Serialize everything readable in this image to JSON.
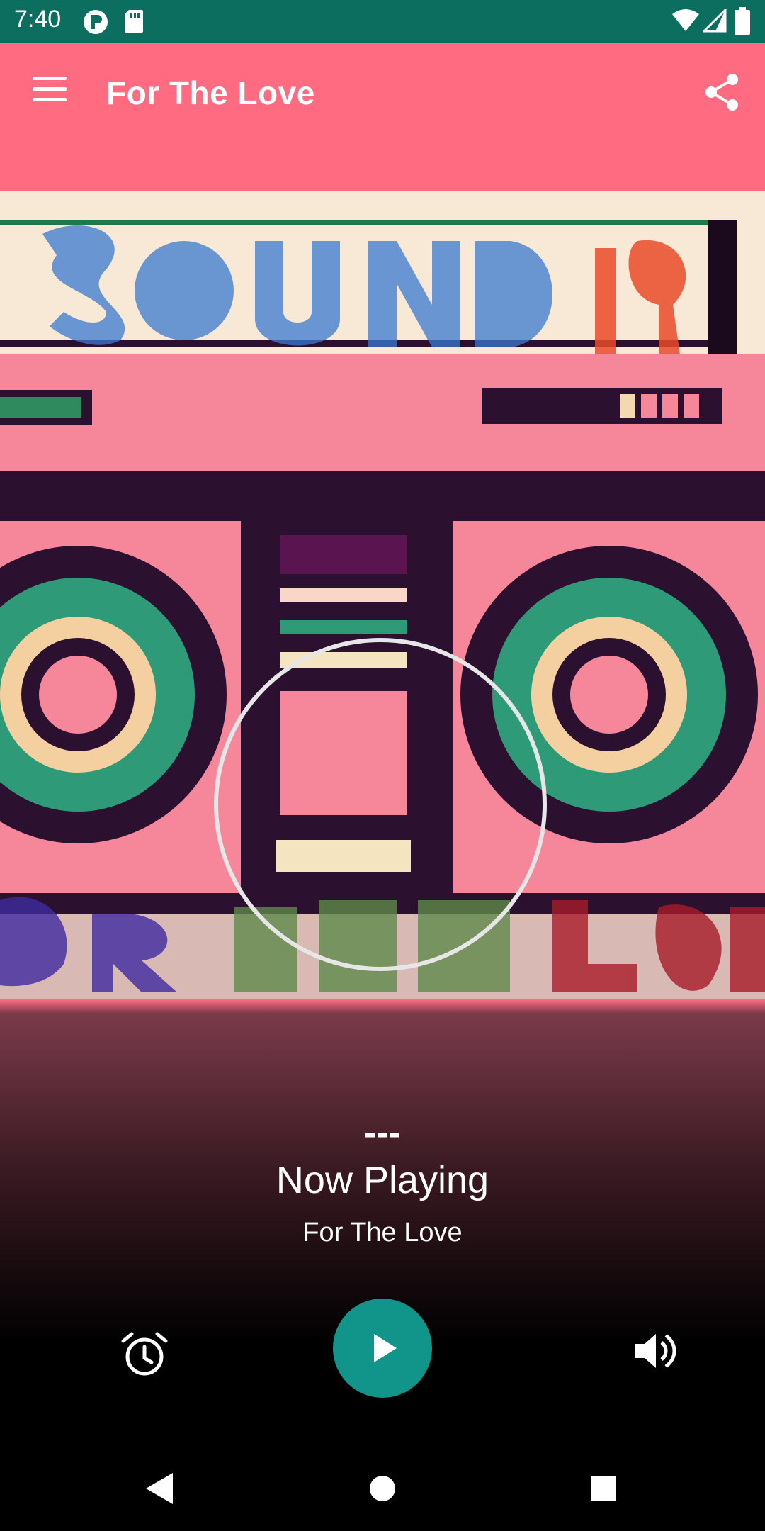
{
  "status_bar": {
    "time": "7:40",
    "icons": [
      "p-icon",
      "sd-card-icon",
      "wifi-icon",
      "signal-icon",
      "battery-icon"
    ]
  },
  "app_bar": {
    "title": "For The Love",
    "menu_icon": "hamburger-menu-icon",
    "share_icon": "share-icon"
  },
  "artwork": {
    "description_icon": "boombox-artwork"
  },
  "now_playing": {
    "dashes": "---",
    "title": "Now Playing",
    "station": "For The Love"
  },
  "controls": {
    "alarm_icon": "alarm-clock-icon",
    "play_icon": "play-icon",
    "volume_icon": "volume-icon"
  },
  "nav_bar": {
    "back_icon": "back-icon",
    "home_icon": "home-icon",
    "recents_icon": "recents-icon"
  },
  "colors": {
    "status_bar": "#0c6e5e",
    "app_bar": "#ff6b81",
    "play_button": "#11948a"
  }
}
